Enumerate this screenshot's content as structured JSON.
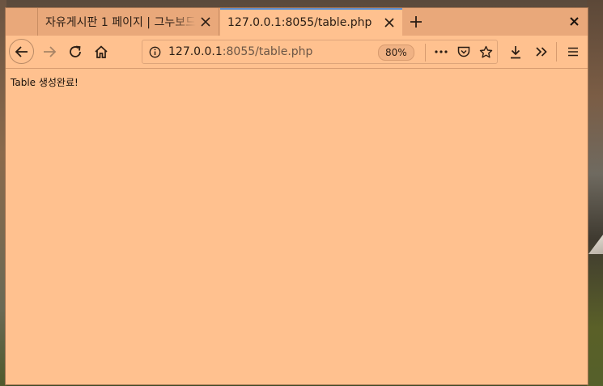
{
  "tabs": [
    {
      "title": "자유게시판 1 페이지 | 그누보드",
      "active": false
    },
    {
      "title": "127.0.0.1:8055/table.php",
      "active": true
    }
  ],
  "address_bar": {
    "host": "127.0.0.1",
    "rest": ":8055/table.php",
    "zoom": "80%"
  },
  "page": {
    "message": "Table 생성완료!"
  },
  "colors": {
    "chrome": "#e9a87a",
    "content": "#ffc18f",
    "active_tab_accent": "#5d8fd0"
  },
  "icons": {
    "back": "arrow-left-icon",
    "forward": "arrow-right-icon",
    "reload": "reload-icon",
    "home": "home-icon",
    "info": "info-icon",
    "page_actions": "more-horizontal-icon",
    "pocket": "pocket-icon",
    "bookmark": "star-icon",
    "downloads": "download-icon",
    "overflow": "chevron-double-right-icon",
    "menu": "hamburger-menu-icon",
    "new_tab": "plus-icon",
    "close": "close-icon"
  }
}
